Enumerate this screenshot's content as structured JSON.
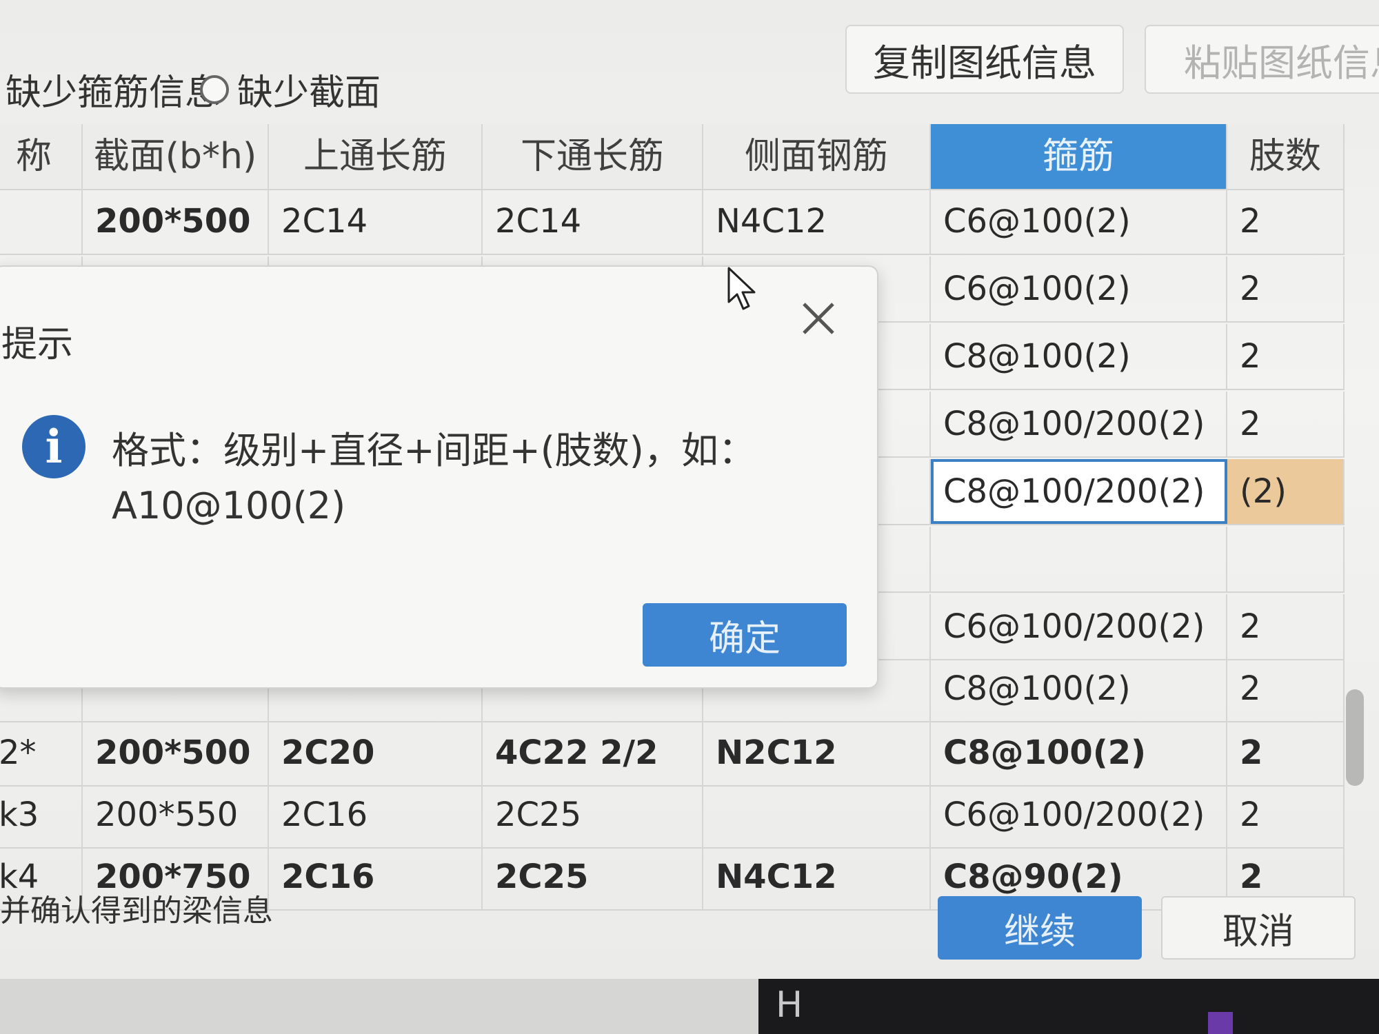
{
  "toolbar": {
    "filter_missing_stirrup": "缺少箍筋信息",
    "filter_missing_section": "缺少截面",
    "copy_button": "复制图纸信息",
    "paste_button": "粘贴图纸信息"
  },
  "table": {
    "headers": {
      "name": "称",
      "section": "截面(b*h)",
      "top_bar": "上通长筋",
      "bottom_bar": "下通长筋",
      "side_bar": "侧面钢筋",
      "stirrup": "箍筋",
      "legs": "肢数"
    },
    "rows": [
      {
        "name": "",
        "section": "200*500",
        "top": "2C14",
        "bottom": "2C14",
        "side": "N4C12",
        "stirrup": "C6@100(2)",
        "legs": "2"
      },
      {
        "name": "",
        "section": "",
        "top": "",
        "bottom": "",
        "side": "",
        "stirrup": "C6@100(2)",
        "legs": "2"
      },
      {
        "name": "",
        "section": "",
        "top": "",
        "bottom": "",
        "side": "",
        "stirrup": "C8@100(2)",
        "legs": "2"
      },
      {
        "name": "",
        "section": "",
        "top": "",
        "bottom": "",
        "side": "",
        "stirrup": "C8@100/200(2)",
        "legs": "2"
      },
      {
        "name": "",
        "section": "",
        "top": "",
        "bottom": "",
        "side": "",
        "stirrup": "C8@100/200(2)",
        "legs": "(2)"
      },
      {
        "name": "",
        "section": "",
        "top": "",
        "bottom": "",
        "side": "",
        "stirrup": "",
        "legs": ""
      },
      {
        "name": "",
        "section": "",
        "top": "",
        "bottom": "",
        "side": "",
        "stirrup": "C6@100/200(2)",
        "legs": "2"
      },
      {
        "name": "",
        "section": "",
        "top": "",
        "bottom": "",
        "side": "",
        "stirrup": "C8@100(2)",
        "legs": "2"
      },
      {
        "name": "2*",
        "section": "200*500",
        "top": "2C20",
        "bottom": "4C22 2/2",
        "side": "N2C12",
        "stirrup": "C8@100(2)",
        "legs": "2"
      },
      {
        "name": "k3",
        "section": "200*550",
        "top": "2C16",
        "bottom": "2C25",
        "side": "",
        "stirrup": "C6@100/200(2)",
        "legs": "2"
      },
      {
        "name": "k4",
        "section": "200*750",
        "top": "2C16",
        "bottom": "2C25",
        "side": "N4C12",
        "stirrup": "C8@90(2)",
        "legs": "2"
      }
    ]
  },
  "dialog": {
    "title": "提示",
    "message_line1": "格式：级别+直径+间距+(肢数)，如：",
    "message_line2": "A10@100(2)",
    "ok_button": "确定",
    "info_icon_glyph": "i"
  },
  "footer": {
    "note": "并确认得到的梁信息",
    "continue_button": "继续",
    "cancel_button": "取消"
  },
  "taskbar": {
    "glyph": "H"
  },
  "colors": {
    "accent_blue": "#3f86d2",
    "active_header": "#3f8fd6",
    "warning_cell": "#ecc99b"
  },
  "icons": {
    "close": "close-icon",
    "info": "info-icon",
    "cursor": "mouse-pointer-icon"
  }
}
